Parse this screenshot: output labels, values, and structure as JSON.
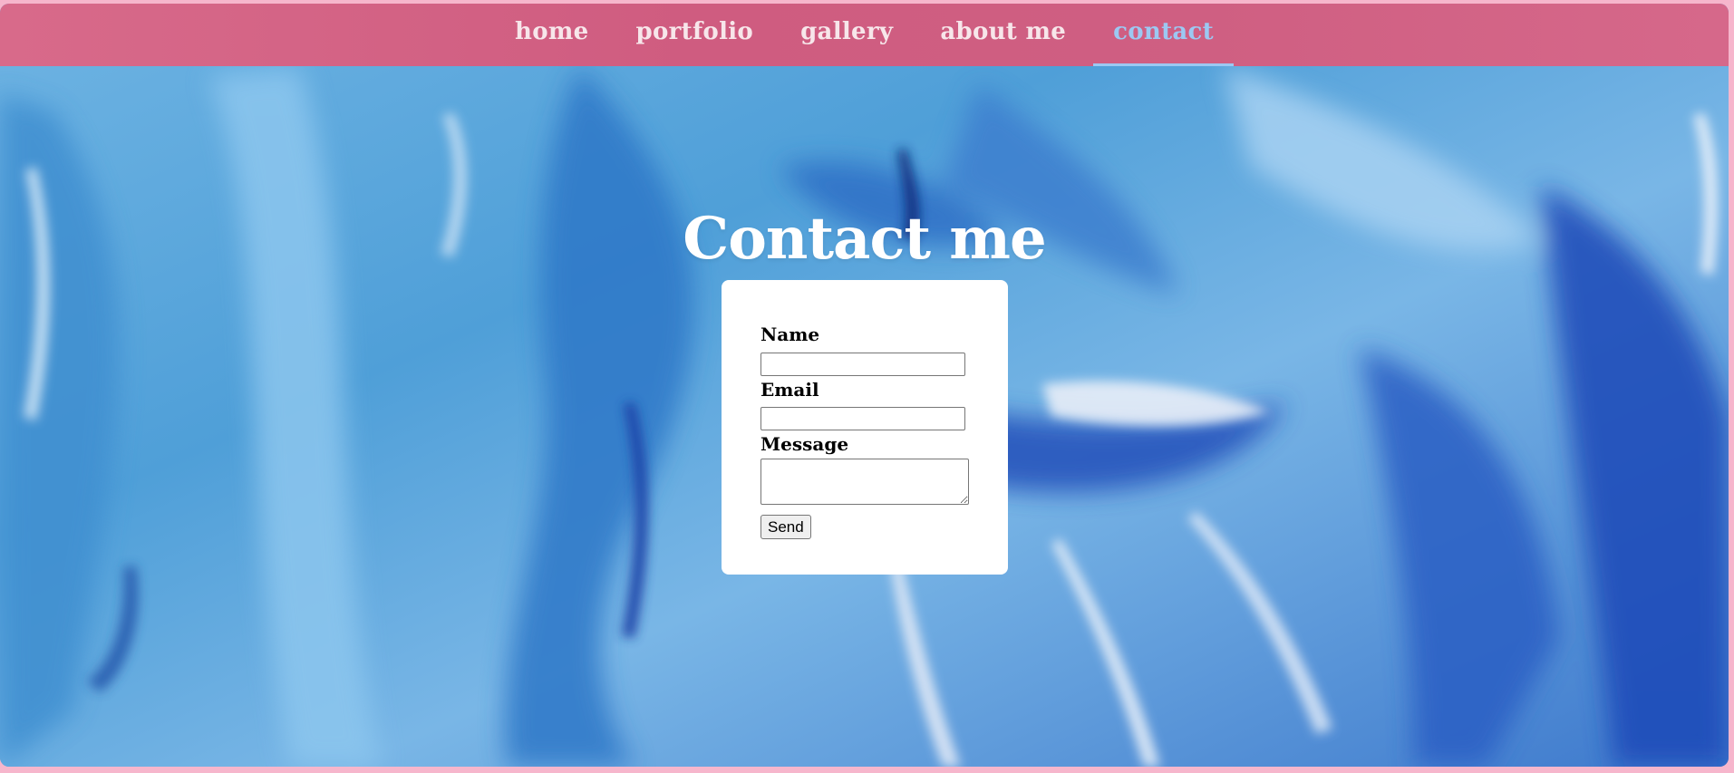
{
  "nav": {
    "items": [
      {
        "label": "home",
        "active": false
      },
      {
        "label": "portfolio",
        "active": false
      },
      {
        "label": "gallery",
        "active": false
      },
      {
        "label": "about me",
        "active": false
      },
      {
        "label": "contact",
        "active": true
      }
    ]
  },
  "hero": {
    "title": "Contact me"
  },
  "form": {
    "name_label": "Name",
    "name_value": "",
    "email_label": "Email",
    "email_value": "",
    "message_label": "Message",
    "message_value": "",
    "send_label": "Send"
  },
  "colors": {
    "page_border": "#f6b6cc",
    "navbar": "#cf5f82",
    "nav_text": "#f7e6ea",
    "nav_active": "#9cc8f2",
    "title": "#ffffff",
    "card": "#ffffff"
  }
}
